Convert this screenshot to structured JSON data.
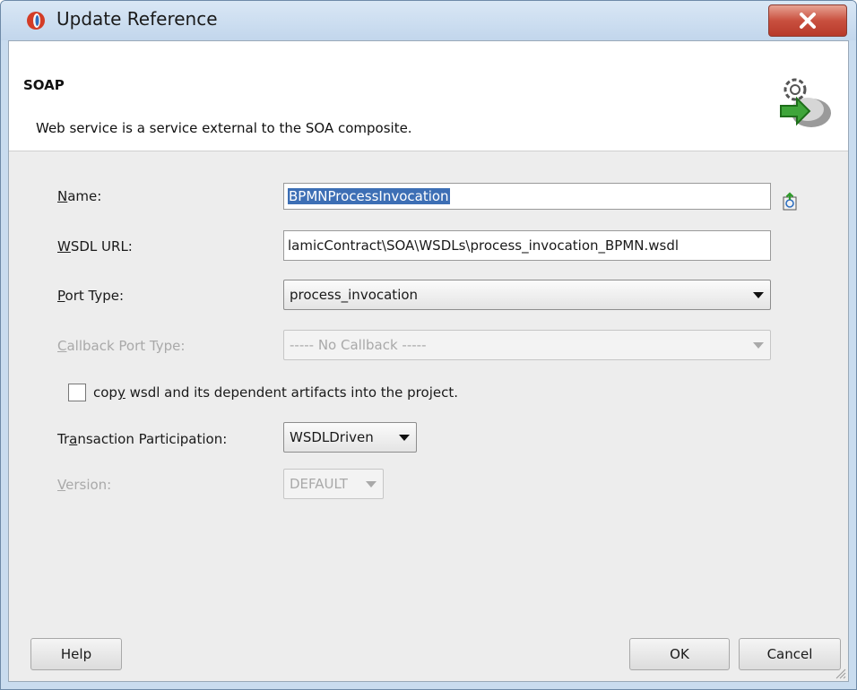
{
  "window": {
    "title": "Update Reference"
  },
  "header": {
    "title": "SOAP",
    "description": "Web service is a service external to the SOA composite."
  },
  "form": {
    "name": {
      "label_mnemonic": "N",
      "label_rest": "ame:",
      "value": "BPMNProcessInvocation"
    },
    "wsdl_url": {
      "label_mnemonic": "W",
      "label_rest": "SDL URL:",
      "value": "lamicContract\\SOA\\WSDLs\\process_invocation_BPMN.wsdl"
    },
    "port_type": {
      "label_mnemonic": "P",
      "label_rest": "ort Type:",
      "value": "process_invocation"
    },
    "callback_port_type": {
      "label_mnemonic": "C",
      "label_rest": "allback Port Type:",
      "value": "----- No Callback -----"
    },
    "copy_wsdl": {
      "label_pre": "cop",
      "label_mnemonic": "y",
      "label_rest": " wsdl and its dependent artifacts into the project.",
      "checked": false
    },
    "transaction": {
      "label_pre": "Tr",
      "label_mnemonic": "a",
      "label_rest": "nsaction Participation:",
      "value": "WSDLDriven"
    },
    "version": {
      "label_mnemonic": "V",
      "label_rest": "ersion:",
      "value": "DEFAULT"
    }
  },
  "buttons": {
    "help": "Help",
    "ok": "OK",
    "cancel": "Cancel"
  },
  "colors": {
    "selection": "#3d6fb5",
    "title_bar": "#c9dcef",
    "close_button": "#c9503f"
  }
}
